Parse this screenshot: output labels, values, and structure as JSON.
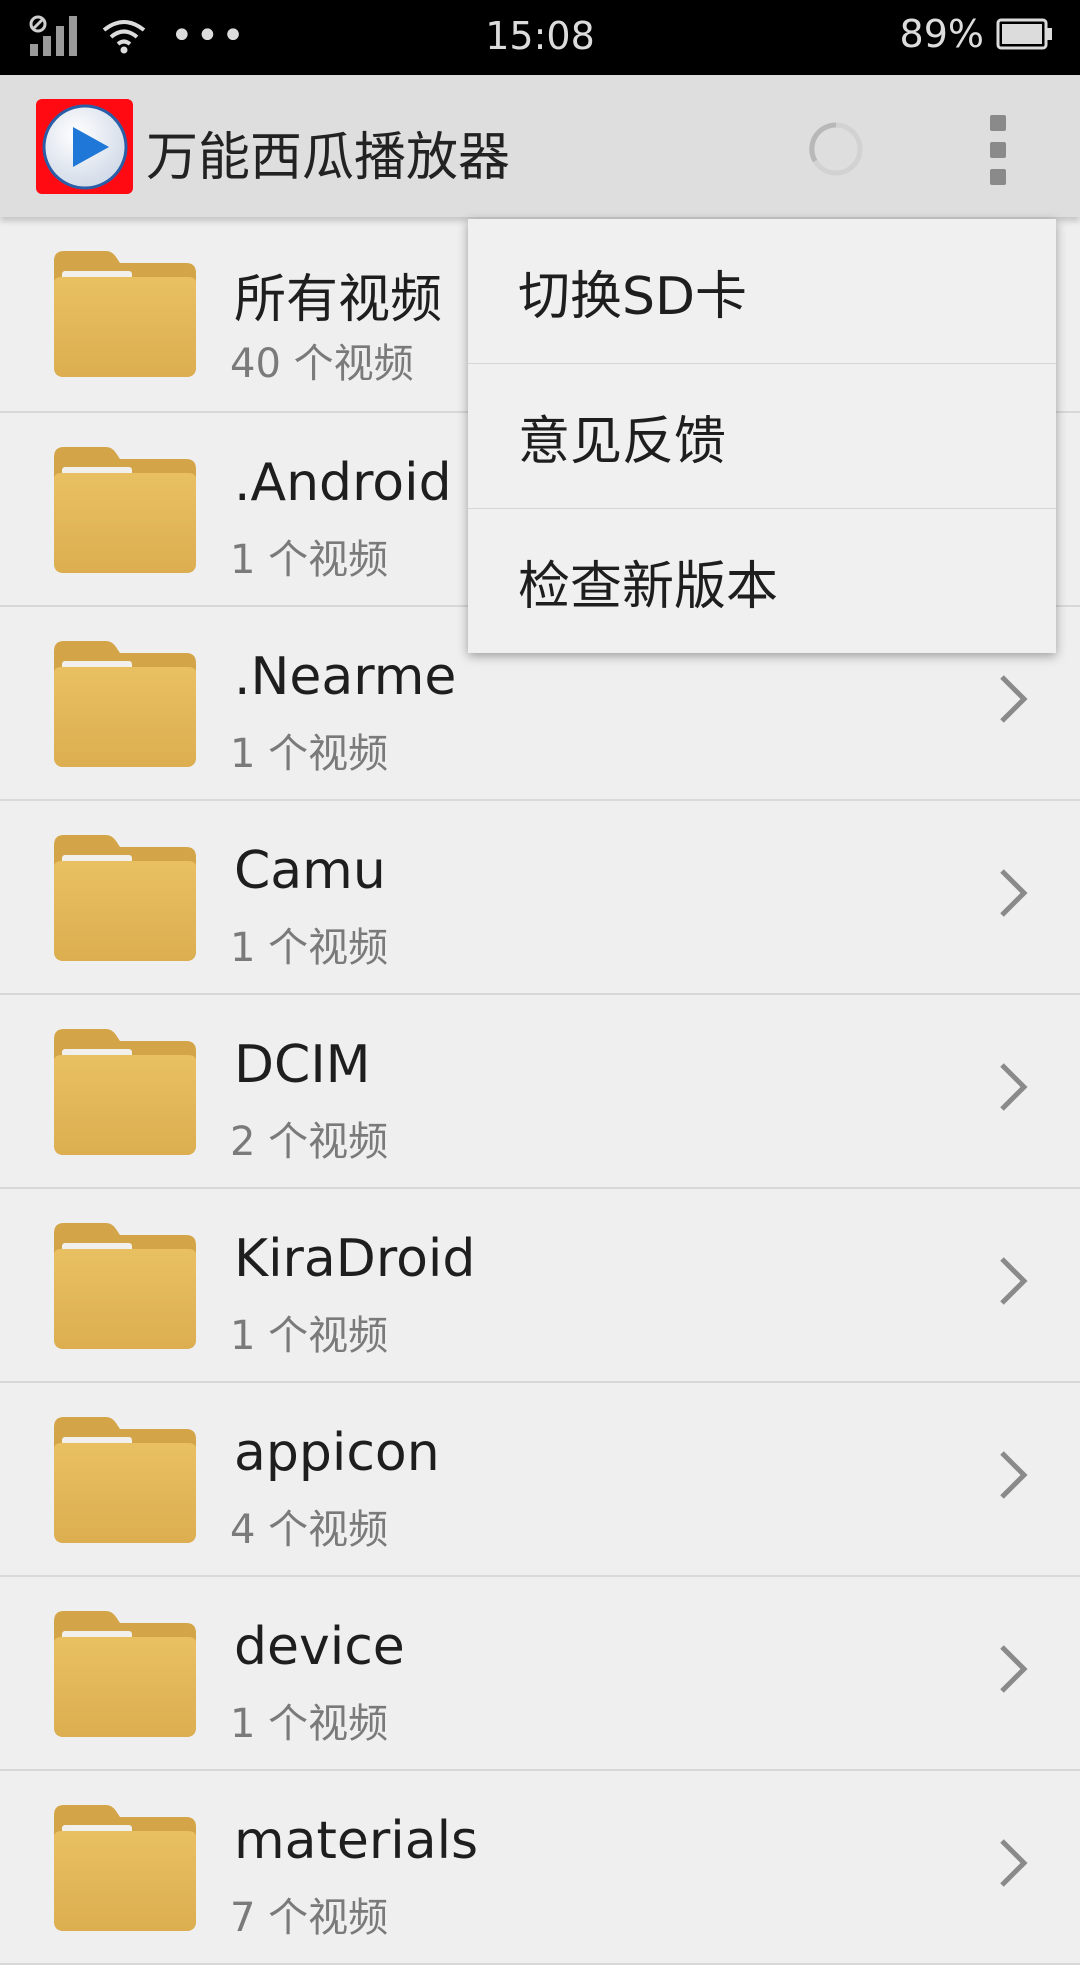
{
  "status_bar": {
    "time": "15:08",
    "battery": "89%",
    "dots": "•••"
  },
  "app_bar": {
    "title": "万能西瓜播放器"
  },
  "menu": {
    "items": [
      {
        "label": "切换SD卡"
      },
      {
        "label": "意见反馈"
      },
      {
        "label": "检查新版本"
      }
    ]
  },
  "folders": [
    {
      "name": "所有视频",
      "count": "40 个视频"
    },
    {
      "name": ".Android",
      "count": "1 个视频"
    },
    {
      "name": ".Nearme",
      "count": "1 个视频"
    },
    {
      "name": "Camu",
      "count": "1 个视频"
    },
    {
      "name": "DCIM",
      "count": "2 个视频"
    },
    {
      "name": "KiraDroid",
      "count": "1 个视频"
    },
    {
      "name": "appicon",
      "count": "4 个视频"
    },
    {
      "name": "device",
      "count": "1 个视频"
    },
    {
      "name": "materials",
      "count": "7 个视频"
    }
  ],
  "colors": {
    "logo_bg": "#ff0a12",
    "folder": "#e2b45a",
    "app_bar": "#dedede"
  }
}
